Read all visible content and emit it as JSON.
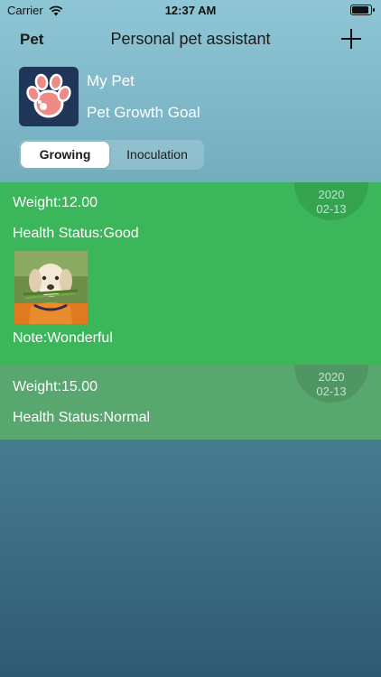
{
  "status_bar": {
    "carrier": "Carrier",
    "time": "12:37 AM"
  },
  "nav": {
    "left_label": "Pet",
    "title": "Personal pet assistant",
    "add_icon": "plus-icon"
  },
  "profile": {
    "avatar_icon": "paw-icon",
    "name": "My Pet",
    "goal": "Pet Growth Goal"
  },
  "segments": {
    "active": "Growing",
    "inactive": "Inoculation"
  },
  "records": [
    {
      "year": "2020",
      "month_day": "02-13",
      "weight": "Weight:12.00",
      "health": "Health Status:Good",
      "note": "Note:Wonderful",
      "photo": "puppy-photo"
    },
    {
      "year": "2020",
      "month_day": "02-13",
      "weight": "Weight:15.00",
      "health": "Health Status:Normal"
    }
  ],
  "colors": {
    "record_good": "#3cb65a",
    "record_normal": "#58a76f",
    "avatar_bg": "#1f3658",
    "paw": "#f08a86"
  }
}
